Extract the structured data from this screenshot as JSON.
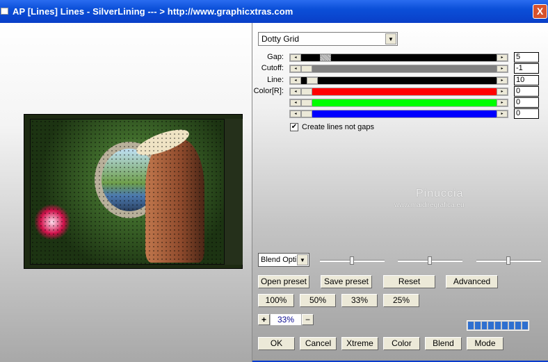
{
  "window": {
    "title": "AP [Lines]  Lines - SilverLining     --- > http://www.graphicxtras.com",
    "close": "X"
  },
  "effect_dropdown": {
    "selected": "Dotty Grid"
  },
  "sliders": [
    {
      "label": "Gap:",
      "value": "5",
      "fill": "#000000",
      "position": 0.1
    },
    {
      "label": "Cutoff:",
      "value": "-1",
      "fill": "#808080",
      "position": 0
    },
    {
      "label": "Line:",
      "value": "10",
      "fill": "#000000",
      "position": 0.03
    },
    {
      "label": "Color[R]:",
      "value": "0",
      "fill": "#ff0000",
      "position": 0
    },
    {
      "label": "",
      "value": "0",
      "fill": "#00ff00",
      "position": 0
    },
    {
      "label": "",
      "value": "0",
      "fill": "#0000ff",
      "position": 0
    }
  ],
  "checkbox": {
    "label": "Create lines not gaps",
    "checked": true
  },
  "watermark": {
    "name": "Pinuccia",
    "url": "www.maidiregrafica.eu"
  },
  "blend_dropdown": {
    "selected": "Blend Opti"
  },
  "color_sliders": [
    {
      "color": "#ff0000",
      "position": 0.5
    },
    {
      "color": "#00ff00",
      "position": 0.5
    },
    {
      "color": "#0000ff",
      "position": 0.5
    }
  ],
  "buttons": {
    "open_preset": "Open preset",
    "save_preset": "Save preset",
    "reset": "Reset",
    "advanced": "Advanced",
    "z100": "100%",
    "z50": "50%",
    "z33": "33%",
    "z25": "25%",
    "plus": "+",
    "minus": "−",
    "ok": "OK",
    "cancel": "Cancel",
    "xtreme": "Xtreme",
    "color": "Color",
    "blend": "Blend",
    "mode": "Mode"
  },
  "zoom_value": "33%",
  "progress_segments": 9
}
